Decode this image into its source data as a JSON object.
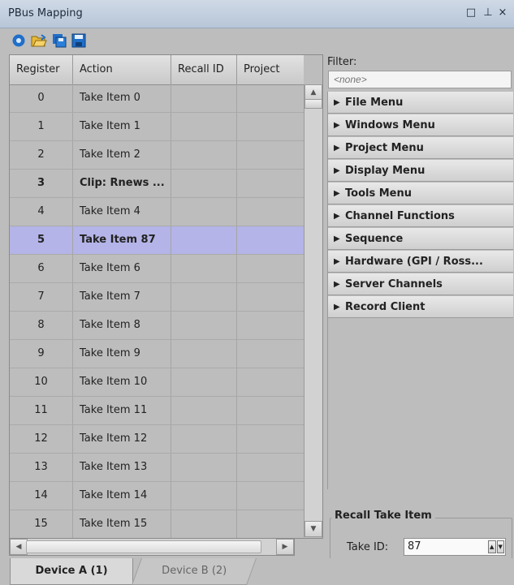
{
  "window": {
    "title": "PBus Mapping"
  },
  "toolbar": {
    "icons": [
      "settings-gear-icon",
      "open-folder-icon",
      "save-copy-icon",
      "save-icon"
    ],
    "colors": {
      "accent": "#1f6fc9",
      "folder": "#e8b83a"
    }
  },
  "grid": {
    "columns": [
      "Register",
      "Action",
      "Recall ID",
      "Project"
    ],
    "rows": [
      {
        "register": "0",
        "action": "Take Item 0",
        "bold": false,
        "selected": false
      },
      {
        "register": "1",
        "action": "Take Item 1",
        "bold": false,
        "selected": false
      },
      {
        "register": "2",
        "action": "Take Item 2",
        "bold": false,
        "selected": false
      },
      {
        "register": "3",
        "action": "Clip: Rnews ...",
        "bold": true,
        "selected": false
      },
      {
        "register": "4",
        "action": "Take Item 4",
        "bold": false,
        "selected": false
      },
      {
        "register": "5",
        "action": "Take Item 87",
        "bold": true,
        "selected": true
      },
      {
        "register": "6",
        "action": "Take Item 6",
        "bold": false,
        "selected": false
      },
      {
        "register": "7",
        "action": "Take Item 7",
        "bold": false,
        "selected": false
      },
      {
        "register": "8",
        "action": "Take Item 8",
        "bold": false,
        "selected": false
      },
      {
        "register": "9",
        "action": "Take Item 9",
        "bold": false,
        "selected": false
      },
      {
        "register": "10",
        "action": "Take Item 10",
        "bold": false,
        "selected": false
      },
      {
        "register": "11",
        "action": "Take Item 11",
        "bold": false,
        "selected": false
      },
      {
        "register": "12",
        "action": "Take Item 12",
        "bold": false,
        "selected": false
      },
      {
        "register": "13",
        "action": "Take Item 13",
        "bold": false,
        "selected": false
      },
      {
        "register": "14",
        "action": "Take Item 14",
        "bold": false,
        "selected": false
      },
      {
        "register": "15",
        "action": "Take Item 15",
        "bold": false,
        "selected": false
      }
    ],
    "selected_color": "#b4b4e8"
  },
  "filter": {
    "label": "Filter:",
    "placeholder": "<none>"
  },
  "categories": [
    "File Menu",
    "Windows Menu",
    "Project Menu",
    "Display Menu",
    "Tools Menu",
    "Channel Functions",
    "Sequence",
    "Hardware (GPI / Ross...",
    "Server Channels",
    "Record Client"
  ],
  "recall": {
    "title": "Recall Take Item",
    "take_id_label": "Take ID:",
    "take_id_value": "87"
  },
  "tabs": {
    "a": "Device A (1)",
    "b": "Device B (2)"
  }
}
